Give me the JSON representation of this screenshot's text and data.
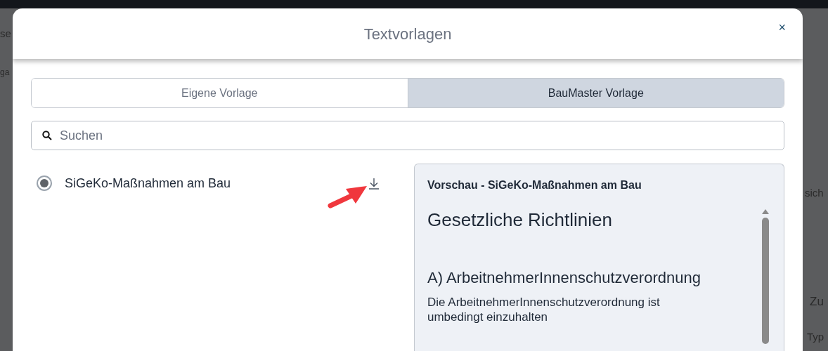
{
  "background": {
    "texts": [
      "se",
      "ga",
      "sich",
      "Zu",
      "Typ"
    ]
  },
  "dialog": {
    "title": "Textvorlagen",
    "close": "×"
  },
  "tabs": [
    {
      "label": "Eigene Vorlage",
      "selected": false
    },
    {
      "label": "BauMaster Vorlage",
      "selected": true
    }
  ],
  "search": {
    "placeholder": "Suchen"
  },
  "templates": [
    {
      "name": "SiGeKo-Maßnahmen am Bau",
      "selected": true
    }
  ],
  "preview": {
    "title": "Vorschau - SiGeKo-Maßnahmen am Bau",
    "heading": "Gesetzliche Richtlinien",
    "subheading": "A) ArbeitnehmerInnenschutzverordnung",
    "paragraph": "Die ArbeitnehmerInnenschutzverordnung ist umbedingt einzuhalten"
  }
}
